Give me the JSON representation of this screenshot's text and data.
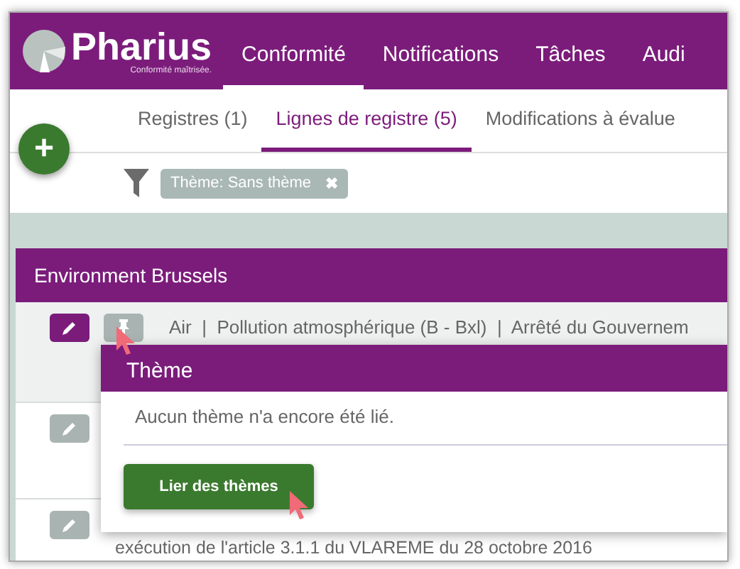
{
  "app": {
    "logo": "Pharius",
    "tagline": "Conformité maîtrisée."
  },
  "nav": [
    {
      "label": "Conformité",
      "selected": true
    },
    {
      "label": "Notifications",
      "selected": false
    },
    {
      "label": "Tâches",
      "selected": false
    },
    {
      "label": "Audi",
      "selected": false
    }
  ],
  "tabs": [
    {
      "label": "Registres (1)",
      "selected": false
    },
    {
      "label": "Lignes de registre (5)",
      "selected": true
    },
    {
      "label": "Modifications à évalue",
      "selected": false
    }
  ],
  "add_button": "+",
  "filter": {
    "chips": [
      {
        "label": "Thème: Sans thème",
        "remove": "✖"
      }
    ]
  },
  "group": {
    "title": "Environment Brussels",
    "rows": [
      {
        "active": true,
        "pin": true,
        "text": "Air  |  Pollution atmosphérique (B - Bxl)  |  Arrêté du Gouvernem"
      },
      {
        "active": false
      },
      {
        "active": false,
        "text": "exécution de l'article 3.1.1 du VLAREME du 28 octobre 2016"
      }
    ]
  },
  "popup": {
    "title": "Thème",
    "message": "Aucun thème n'a encore été lié.",
    "button": "Lier des thèmes"
  }
}
